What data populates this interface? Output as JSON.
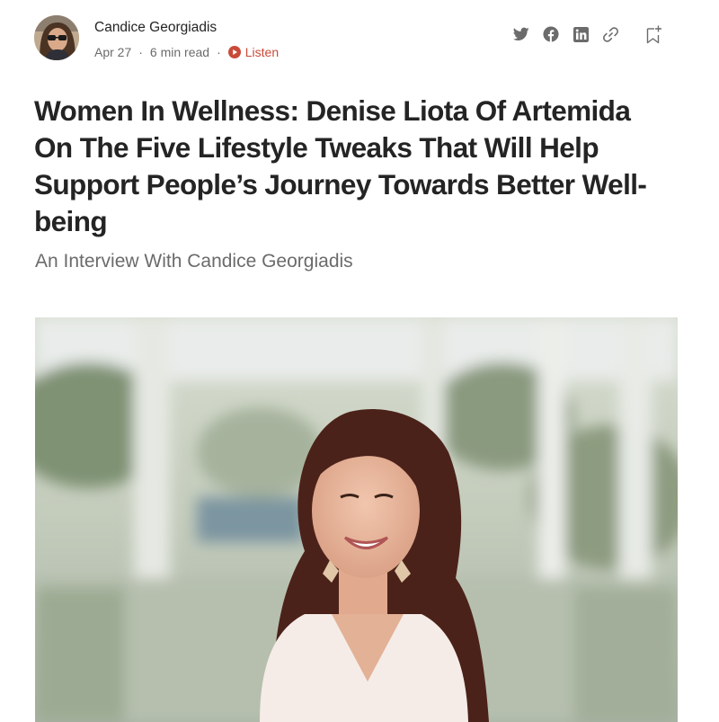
{
  "author": {
    "name": "Candice Georgiadis",
    "date": "Apr 27",
    "read_time": "6 min read",
    "listen_label": "Listen"
  },
  "share_icons": [
    "twitter-icon",
    "facebook-icon",
    "linkedin-icon",
    "link-icon",
    "bookmark-add-icon"
  ],
  "article": {
    "title": "Women In Wellness: Denise Liota Of Artemida On The Five Lifestyle Tweaks That Will Help Support People’s Journey Towards Better Well-being",
    "subtitle": "An Interview With Candice Georgiadis"
  },
  "colors": {
    "text": "#242424",
    "muted": "#6b6b6b",
    "listen": "#c94a38",
    "icon": "#6b6b6b"
  }
}
